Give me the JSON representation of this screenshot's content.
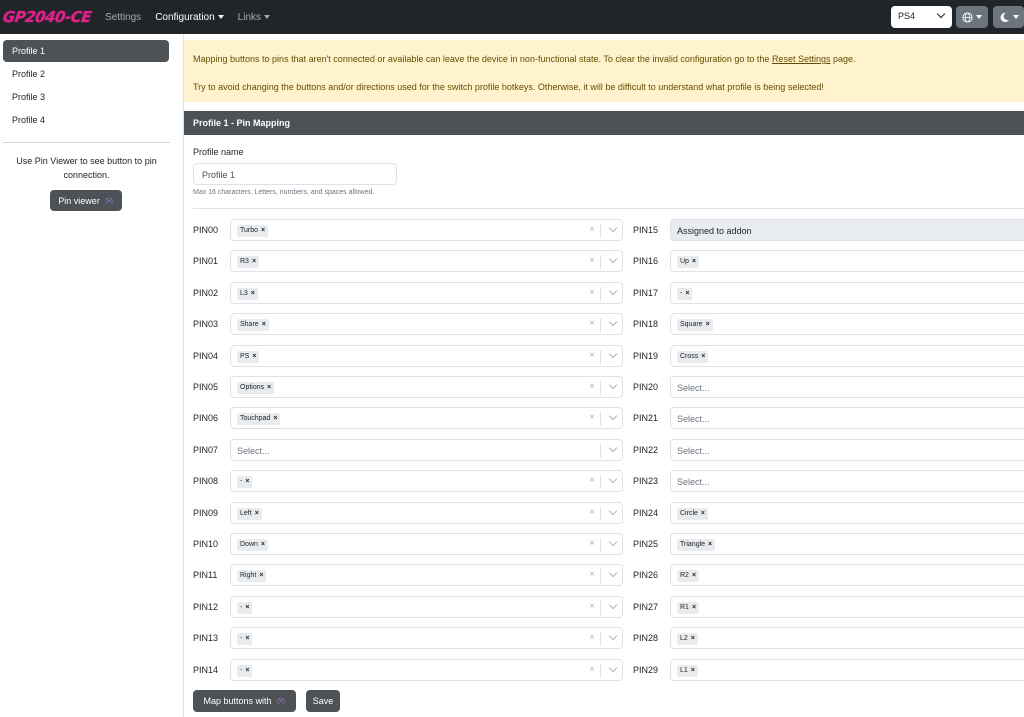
{
  "navbar": {
    "logo": "GP2040-CE",
    "links": [
      "Settings",
      "Configuration",
      "Links"
    ],
    "input_mode": "PS4",
    "language_icon": "globe-icon",
    "theme_icon": "moon-icon"
  },
  "sidebar": {
    "profiles": [
      "Profile 1",
      "Profile 2",
      "Profile 3",
      "Profile 4"
    ],
    "help": "Use Pin Viewer to see button to pin connection.",
    "pin_viewer_label": "Pin viewer"
  },
  "alert": {
    "line1_pre": "Mapping buttons to pins that aren't connected or available can leave the device in non-functional state. To clear the invalid configuration go to the ",
    "line1_link": "Reset Settings",
    "line1_post": " page.",
    "line2": "Try to avoid changing the buttons and/or directions used for the switch profile hotkeys. Otherwise, it will be difficult to understand what profile is being selected!"
  },
  "card": {
    "title": "Profile 1 - Pin Mapping",
    "profile_name_label": "Profile name",
    "profile_name_value": "Profile 1",
    "profile_name_help": "Max 16 characters. Letters, numbers, and spaces allowed."
  },
  "placeholder": "Select...",
  "pins_left": [
    {
      "pin": "PIN00",
      "value": "Turbo"
    },
    {
      "pin": "PIN01",
      "value": "R3"
    },
    {
      "pin": "PIN02",
      "value": "L3"
    },
    {
      "pin": "PIN03",
      "value": "Share"
    },
    {
      "pin": "PIN04",
      "value": "PS"
    },
    {
      "pin": "PIN05",
      "value": "Options"
    },
    {
      "pin": "PIN06",
      "value": "Touchpad"
    },
    {
      "pin": "PIN07",
      "value": ""
    },
    {
      "pin": "PIN08",
      "value": "-"
    },
    {
      "pin": "PIN09",
      "value": "Left"
    },
    {
      "pin": "PIN10",
      "value": "Down"
    },
    {
      "pin": "PIN11",
      "value": "Right"
    },
    {
      "pin": "PIN12",
      "value": "-"
    },
    {
      "pin": "PIN13",
      "value": "-"
    },
    {
      "pin": "PIN14",
      "value": "-"
    }
  ],
  "pins_right": [
    {
      "pin": "PIN15",
      "value": "Assigned to addon",
      "disabled": true
    },
    {
      "pin": "PIN16",
      "value": "Up"
    },
    {
      "pin": "PIN17",
      "value": "-"
    },
    {
      "pin": "PIN18",
      "value": "Square"
    },
    {
      "pin": "PIN19",
      "value": "Cross"
    },
    {
      "pin": "PIN20",
      "value": ""
    },
    {
      "pin": "PIN21",
      "value": ""
    },
    {
      "pin": "PIN22",
      "value": ""
    },
    {
      "pin": "PIN23",
      "value": ""
    },
    {
      "pin": "PIN24",
      "value": "Circle"
    },
    {
      "pin": "PIN25",
      "value": "Triangle"
    },
    {
      "pin": "PIN26",
      "value": "R2"
    },
    {
      "pin": "PIN27",
      "value": "R1"
    },
    {
      "pin": "PIN28",
      "value": "L2"
    },
    {
      "pin": "PIN29",
      "value": "L1"
    }
  ],
  "footer": {
    "map_label": "Map buttons with",
    "save_label": "Save"
  }
}
